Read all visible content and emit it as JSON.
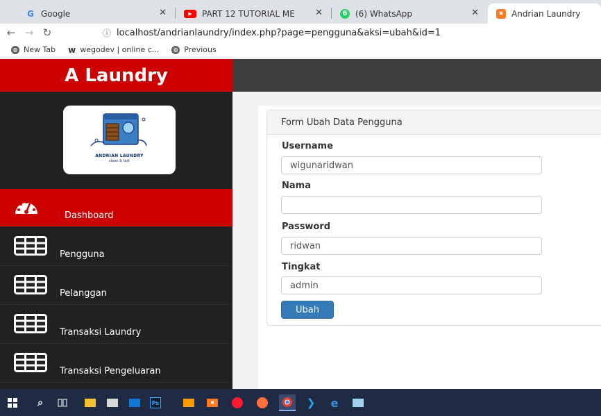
{
  "browser": {
    "tabs": [
      {
        "title": "Google",
        "icon": "google-g-icon",
        "color": "#4285f4"
      },
      {
        "title": "PART 12 TUTORIAL ME",
        "icon": "youtube-icon",
        "color": "#ff0000"
      },
      {
        "title": "(6) WhatsApp",
        "icon": "whatsapp-icon",
        "badge": "6",
        "color": "#25d366"
      },
      {
        "title": "Andrian Laundry",
        "icon": "xampp-icon",
        "color": "#fb7a24"
      }
    ],
    "url": "localhost/andrianlaundry/index.php?page=pengguna&aksi=ubah&id=1",
    "bookmarks": [
      {
        "label": "New Tab",
        "icon": "globe-icon"
      },
      {
        "label": "wegodev | online c...",
        "icon": "wegodev-w-icon"
      },
      {
        "label": "Previous",
        "icon": "globe-icon"
      }
    ]
  },
  "app": {
    "brand": "A Laundry",
    "logo": {
      "name": "ANDRIAN LAUNDRY",
      "tagline": "clean & fast"
    },
    "colors": {
      "brand_red": "#cc0000",
      "sidebar": "#212121",
      "topbar": "#3d3d3d",
      "primary": "#337ab7"
    },
    "menu": [
      {
        "label": "Dashboard",
        "icon": "dashboard-gauge-icon",
        "active": true
      },
      {
        "label": "Pengguna",
        "icon": "table-icon"
      },
      {
        "label": "Pelanggan",
        "icon": "table-icon"
      },
      {
        "label": "Transaksi Laundry",
        "icon": "table-icon"
      },
      {
        "label": "Transaksi Pengeluaran",
        "icon": "table-icon"
      }
    ]
  },
  "form": {
    "title": "Form Ubah Data Pengguna",
    "fields": [
      {
        "label": "Username",
        "value": "wigunaridwan"
      },
      {
        "label": "Nama",
        "value": ""
      },
      {
        "label": "Password",
        "value": "ridwan"
      },
      {
        "label": "Tingkat",
        "value": "admin"
      }
    ],
    "submit_label": "Ubah"
  },
  "taskbar": {
    "icons": [
      "windows-start-icon",
      "search-icon",
      "task-view-icon",
      "file-explorer-icon",
      "store-icon",
      "mail-icon",
      "photoshop-icon",
      "sublime-icon",
      "xampp-icon",
      "opera-icon",
      "firefox-icon",
      "chrome-icon",
      "vscode-icon",
      "edge-icon",
      "notepad-icon"
    ],
    "photoshop_label": "Ps"
  }
}
